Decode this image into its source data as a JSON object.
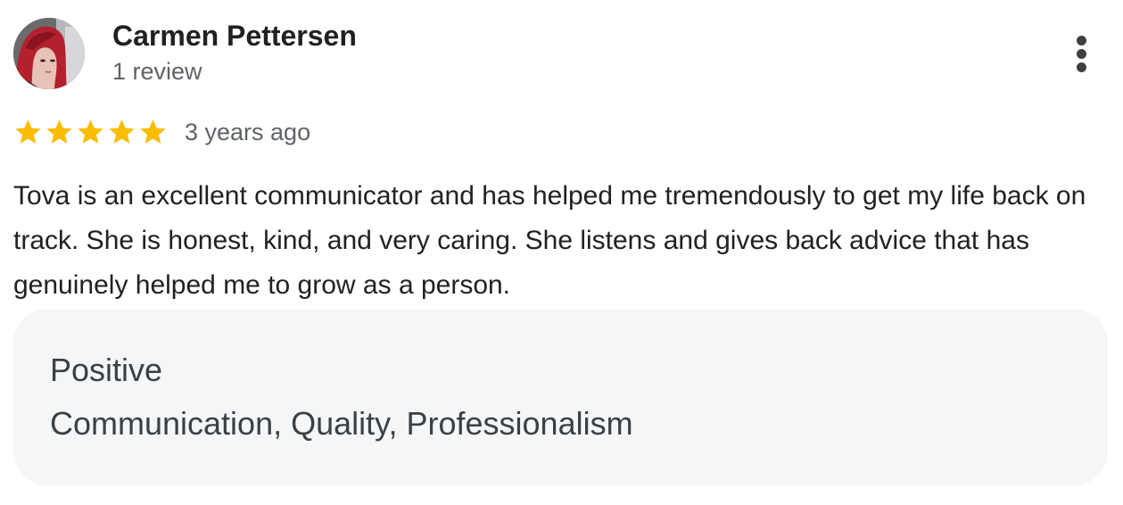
{
  "reviewer": {
    "name": "Carmen Pettersen",
    "review_count": "1 review",
    "avatar_icon": "user-avatar-photo"
  },
  "menu": {
    "icon": "more-vertical-icon"
  },
  "rating": {
    "stars": 5,
    "max_stars": 5,
    "star_color": "#fbbc04",
    "timestamp": "3 years ago"
  },
  "review": {
    "text": "Tova is an excellent communicator and has helped me tremendously to get my life back on track. She is honest, kind, and very caring. She listens and gives back advice that has genuinely helped me to grow as a person."
  },
  "attributes": {
    "heading": "Positive",
    "values": "Communication, Quality, Professionalism",
    "background_color": "#f5f6f8"
  }
}
